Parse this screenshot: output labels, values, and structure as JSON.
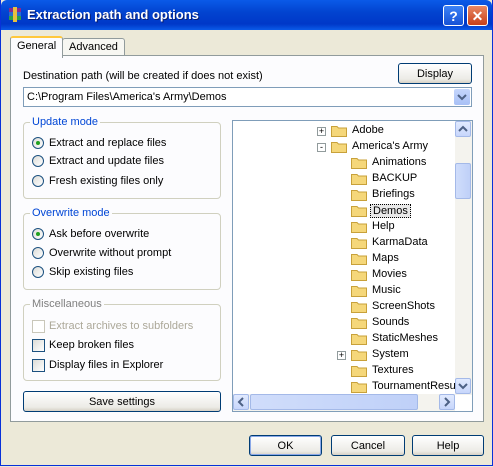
{
  "window": {
    "title": "Extraction path and options",
    "help_button": "?",
    "close_button": "✕"
  },
  "tabs": [
    {
      "label": "General",
      "active": true
    },
    {
      "label": "Advanced",
      "active": false
    }
  ],
  "destination": {
    "label": "Destination path (will be created if does not exist)",
    "value": "C:\\Program Files\\America's Army\\Demos",
    "display_button": "Display"
  },
  "update_mode": {
    "title": "Update mode",
    "options": [
      {
        "label": "Extract and replace files",
        "selected": true
      },
      {
        "label": "Extract and update files",
        "selected": false
      },
      {
        "label": "Fresh existing files only",
        "selected": false
      }
    ]
  },
  "overwrite_mode": {
    "title": "Overwrite mode",
    "options": [
      {
        "label": "Ask before overwrite",
        "selected": true
      },
      {
        "label": "Overwrite without prompt",
        "selected": false
      },
      {
        "label": "Skip existing files",
        "selected": false
      }
    ]
  },
  "miscellaneous": {
    "title": "Miscellaneous",
    "options": [
      {
        "label": "Extract archives to subfolders",
        "checked": false,
        "enabled": false
      },
      {
        "label": "Keep broken files",
        "checked": false,
        "enabled": true
      },
      {
        "label": "Display files in Explorer",
        "checked": false,
        "enabled": true
      }
    ]
  },
  "save_settings_button": "Save settings",
  "folder_tree": {
    "items": [
      {
        "label": "Adobe",
        "level": 0,
        "expander": "+"
      },
      {
        "label": "America's Army",
        "level": 0,
        "expander": "-"
      },
      {
        "label": "Animations",
        "level": 1,
        "expander": ""
      },
      {
        "label": "BACKUP",
        "level": 1,
        "expander": ""
      },
      {
        "label": "Briefings",
        "level": 1,
        "expander": ""
      },
      {
        "label": "Demos",
        "level": 1,
        "expander": "",
        "selected": true
      },
      {
        "label": "Help",
        "level": 1,
        "expander": ""
      },
      {
        "label": "KarmaData",
        "level": 1,
        "expander": ""
      },
      {
        "label": "Maps",
        "level": 1,
        "expander": ""
      },
      {
        "label": "Movies",
        "level": 1,
        "expander": ""
      },
      {
        "label": "Music",
        "level": 1,
        "expander": ""
      },
      {
        "label": "ScreenShots",
        "level": 1,
        "expander": ""
      },
      {
        "label": "Sounds",
        "level": 1,
        "expander": ""
      },
      {
        "label": "StaticMeshes",
        "level": 1,
        "expander": ""
      },
      {
        "label": "System",
        "level": 1,
        "expander": "+"
      },
      {
        "label": "Textures",
        "level": 1,
        "expander": ""
      },
      {
        "label": "TournamentResu",
        "level": 1,
        "expander": ""
      }
    ]
  },
  "footer": {
    "ok": "OK",
    "cancel": "Cancel",
    "help": "Help"
  },
  "colors": {
    "titlebar": "#0a5ae8",
    "group_title": "#0046d5",
    "folder": "#f5d77a",
    "radio_dot": "#21a121"
  }
}
